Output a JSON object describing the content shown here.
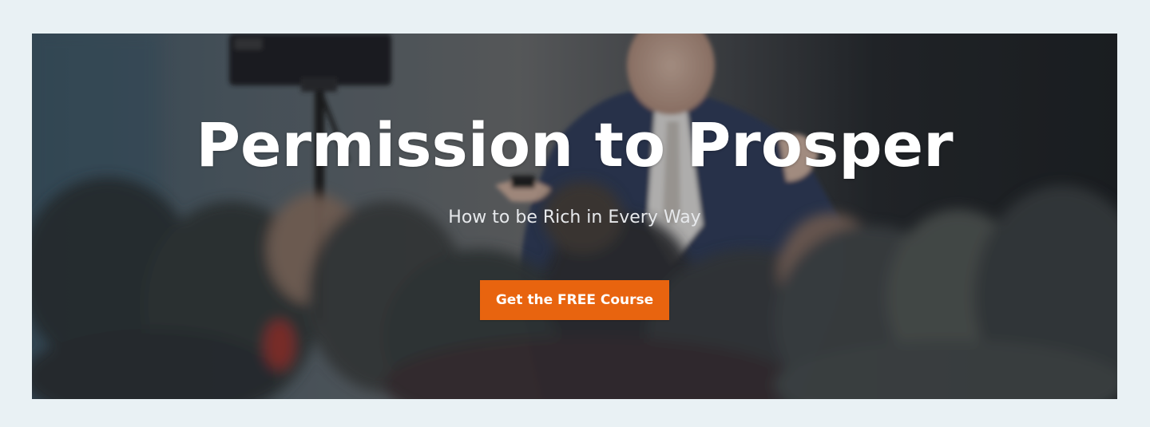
{
  "hero": {
    "title": "Permission to Prosper",
    "subtitle": "How to be Rich in Every Way",
    "cta_label": "Get the FREE Course",
    "image_alt": "Speaker in blue suit presenting to an audience"
  },
  "colors": {
    "page_background": "#e9f1f4",
    "cta_background": "#e8640f",
    "title_text": "#ffffff"
  }
}
